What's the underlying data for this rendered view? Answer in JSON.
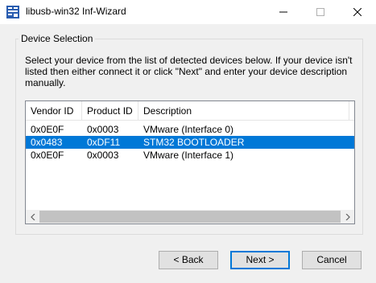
{
  "window": {
    "title": "libusb-win32 Inf-Wizard",
    "app_icon": "libusb-icon"
  },
  "group": {
    "label": "Device Selection",
    "instructions": "Select your device from the list of detected devices below. If your device isn't listed then either connect it or click \"Next\" and enter your device description manually."
  },
  "device_list": {
    "columns": [
      "Vendor ID",
      "Product ID",
      "Description"
    ],
    "rows": [
      {
        "vendor": "0x0E0F",
        "product": "0x0003",
        "description": "VMware (Interface 0)",
        "selected": false
      },
      {
        "vendor": "0x0483",
        "product": "0xDF11",
        "description": "STM32  BOOTLOADER",
        "selected": true
      },
      {
        "vendor": "0x0E0F",
        "product": "0x0003",
        "description": "VMware (Interface 1)",
        "selected": false
      }
    ]
  },
  "buttons": {
    "back": "< Back",
    "next": "Next >",
    "cancel": "Cancel"
  },
  "colors": {
    "selection": "#0078d7",
    "window_bg": "#f0f0f0"
  }
}
